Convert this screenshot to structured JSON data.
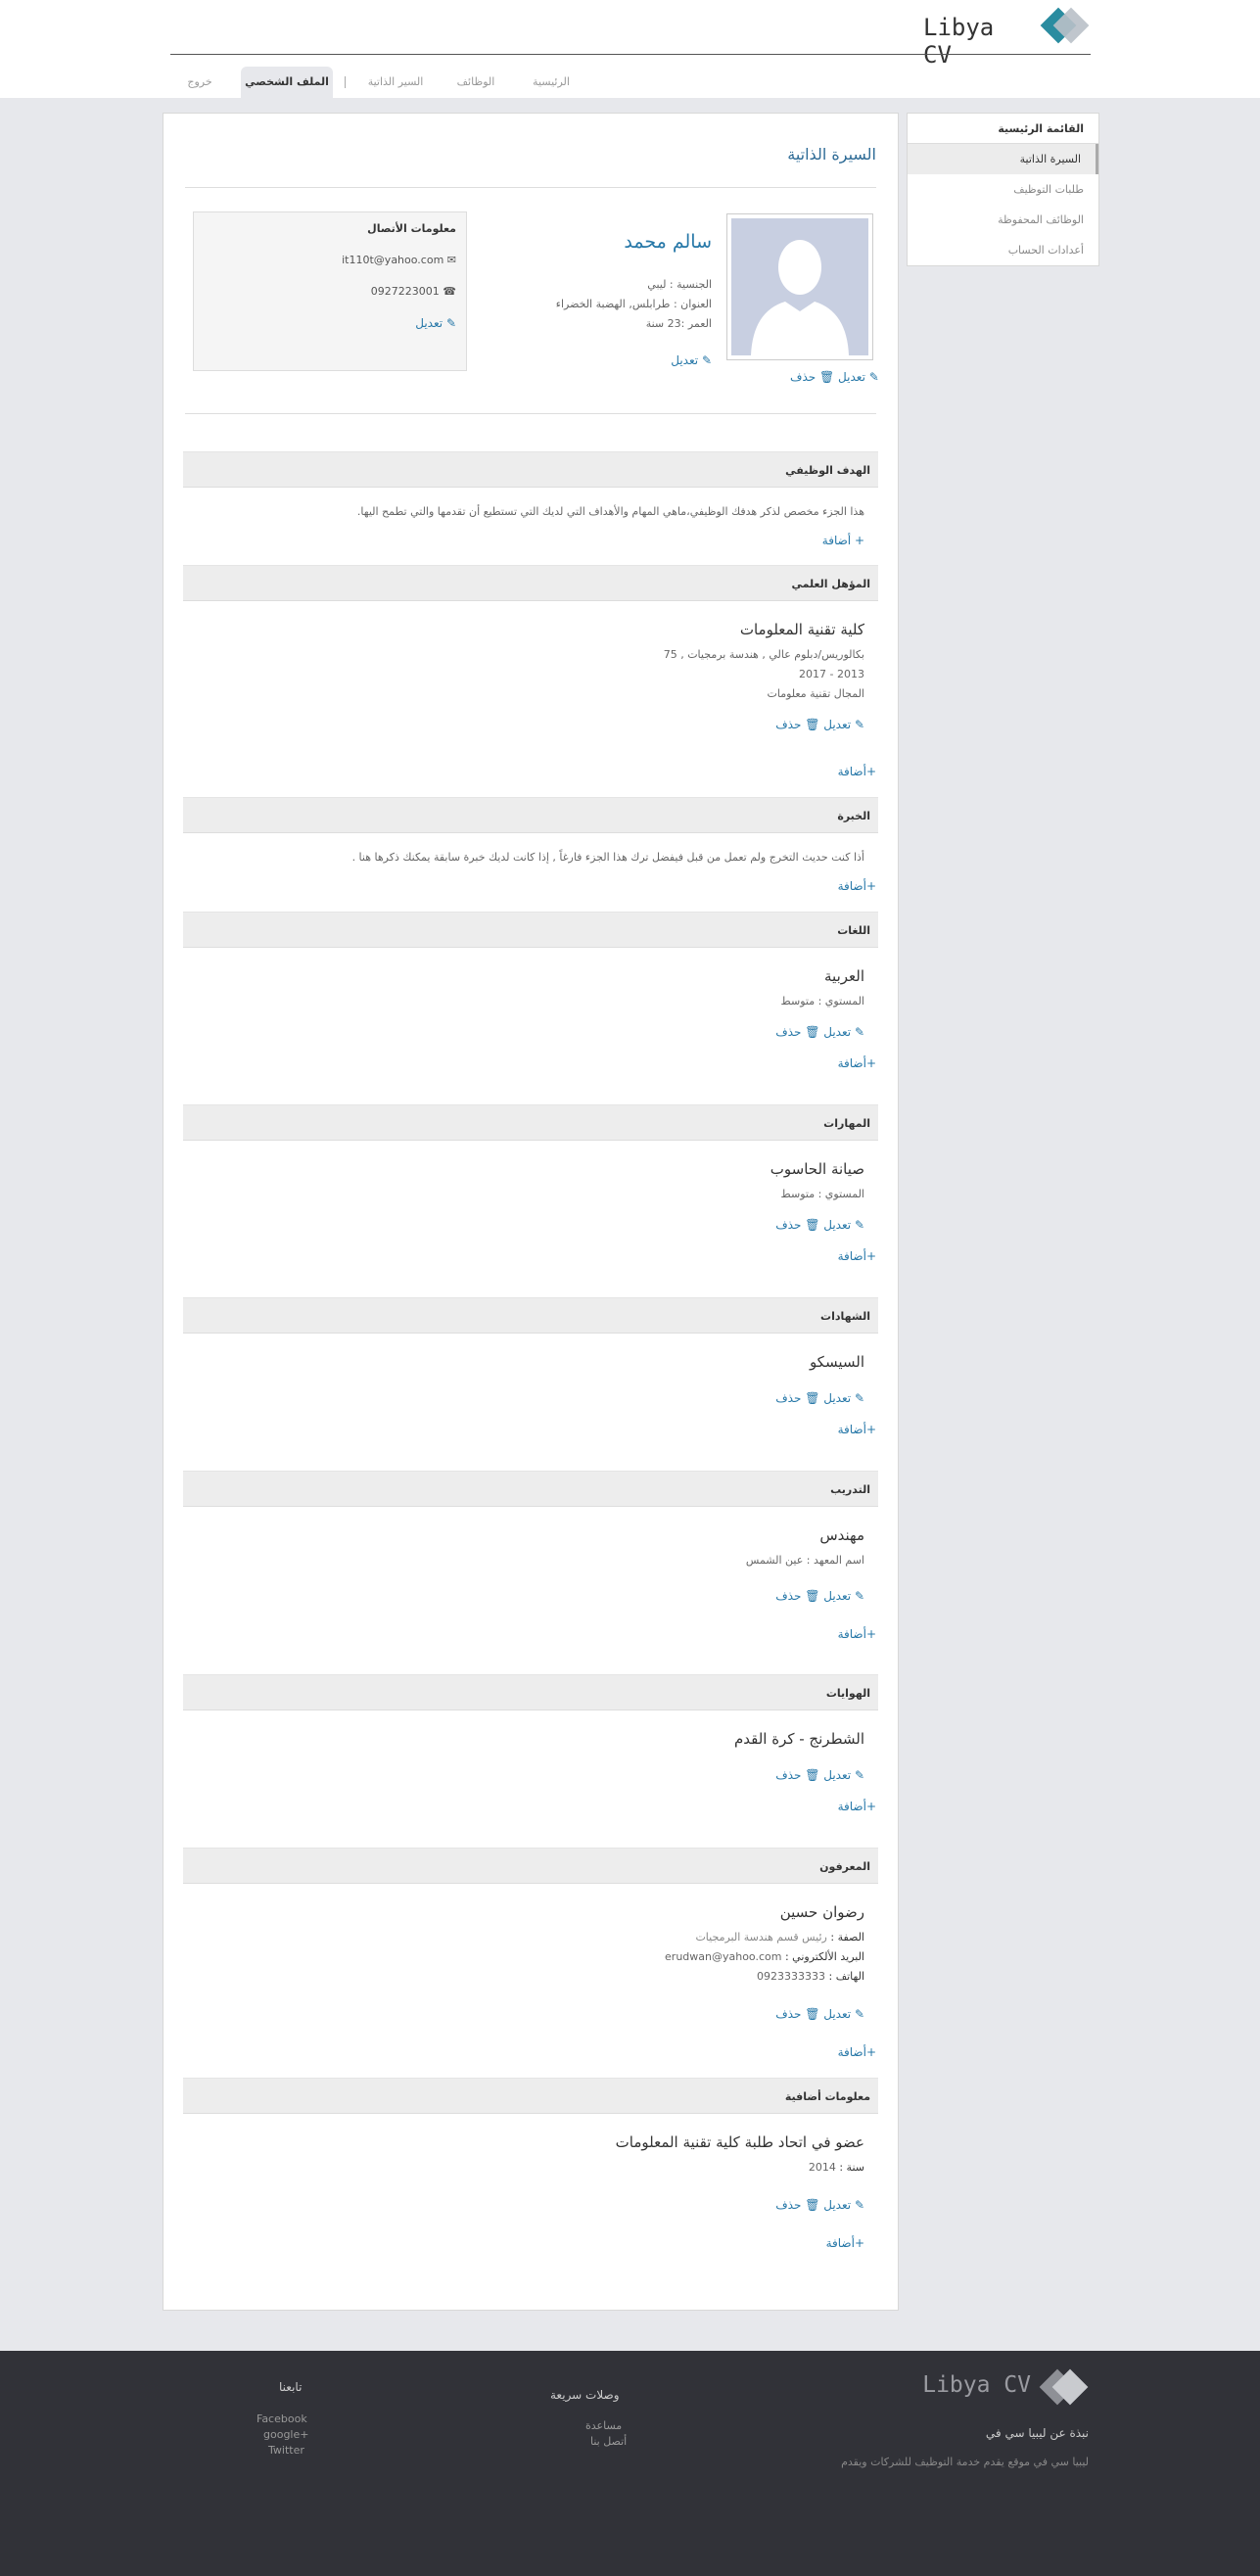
{
  "header": {
    "logo_text": "Libya CV",
    "nav": {
      "home": "الرئيسية",
      "jobs": "الوظائف",
      "cvs": "السير الذاتية",
      "profile": "الملف الشخصي",
      "logout": "خروج"
    }
  },
  "sidebar": {
    "title": "القائمة الرئيسية",
    "items": [
      "السيرة الذاتية",
      "طلبات التوظيف",
      "الوظائف المحفوظة",
      "أعدادات الحساب"
    ]
  },
  "main": {
    "title": "السيرة الذاتية",
    "profile": {
      "name": "سالم محمد",
      "nationality": "الجنسية : ليبي",
      "address": "العنوان : طرابلس, الهضبة الخضراء",
      "age": "العمر :23 سنة",
      "edit": "تعديل",
      "photo_edit": "تعديل",
      "photo_delete": "حذف"
    },
    "contact": {
      "title": "معلومات الأتصال",
      "email": "it110t@yahoo.com",
      "phone": "0927223001",
      "edit": "تعديل"
    },
    "labels": {
      "edit": "تعديل",
      "delete": "حذف",
      "add": "أضافة"
    },
    "objective": {
      "title": "الهدف الوظيفي",
      "text": "هذا الجزء مخصص لذكر هدفك الوظيفي،ماهي المهام والأهداف التي لديك التي تستطيع أن تقدمها والتي تطمح اليها.",
      "add": "+ أضافة"
    },
    "education": {
      "title": "المؤهل العلمي",
      "name": "كلية تقنية المعلومات",
      "degree": "بكالوريس/دبلوم عالي , هندسة برمجيات , 75",
      "years": "2013 - 2017",
      "field": "المجال تقنية معلومات",
      "add": "+أضافة"
    },
    "experience": {
      "title": "الخبرة",
      "text": "أذا كنت حديث التخرج ولم تعمل من قبل فيفضل ترك هذا الجزء فارغاً , إذا كانت لديك خبرة سابقة يمكنك ذكرها هنا .",
      "add": "+أضافة"
    },
    "languages": {
      "title": "اللغات",
      "name": "العربية",
      "level_label": "المستوي :",
      "level": "متوسط",
      "add": "+أضافة"
    },
    "skills": {
      "title": "المهارات",
      "name": "صيانة الحاسوب",
      "level_label": "المستوي :",
      "level": "متوسط",
      "add": "+أضافة"
    },
    "certificates": {
      "title": "الشهادات",
      "name": "السيسكو",
      "add": "+أضافة"
    },
    "training": {
      "title": "التدريب",
      "name": "مهندس",
      "institute_label": "اسم المعهد :",
      "institute": "عين الشمس",
      "add": "+أضافة"
    },
    "hobbies": {
      "title": "الهوايات",
      "name": "الشطرنج - كرة القدم",
      "add": "+أضافة"
    },
    "references": {
      "title": "المعرفون",
      "name": "رضوان حسين",
      "role_label": "الصفة :",
      "role": "رئيس قسم هندسة البرمجيات",
      "email_label": "البريد الألكتروني :",
      "email": "erudwan@yahoo.com",
      "phone_label": "الهاتف :",
      "phone": "0923333333",
      "add": "+أضافة"
    },
    "additional": {
      "title": "معلومات أضافية",
      "name": "عضو في اتحاد طلبة كلية تقنية المعلومات",
      "year_label": "سنة :",
      "year": "2014",
      "add": "+أضافة"
    }
  },
  "footer": {
    "logo_text": "Libya CV",
    "about_title": "نبذة عن ليبيا سي في",
    "about_text": "ليبيا سي في موقع يقدم خدمة التوظيف للشركات ويقدم",
    "links_title": "وصلات سريعة",
    "links": [
      "مساعدة",
      "أتصل بنا"
    ],
    "follow_title": "تابعنا",
    "social": [
      "Facebook",
      "google+",
      "Twitter"
    ]
  }
}
